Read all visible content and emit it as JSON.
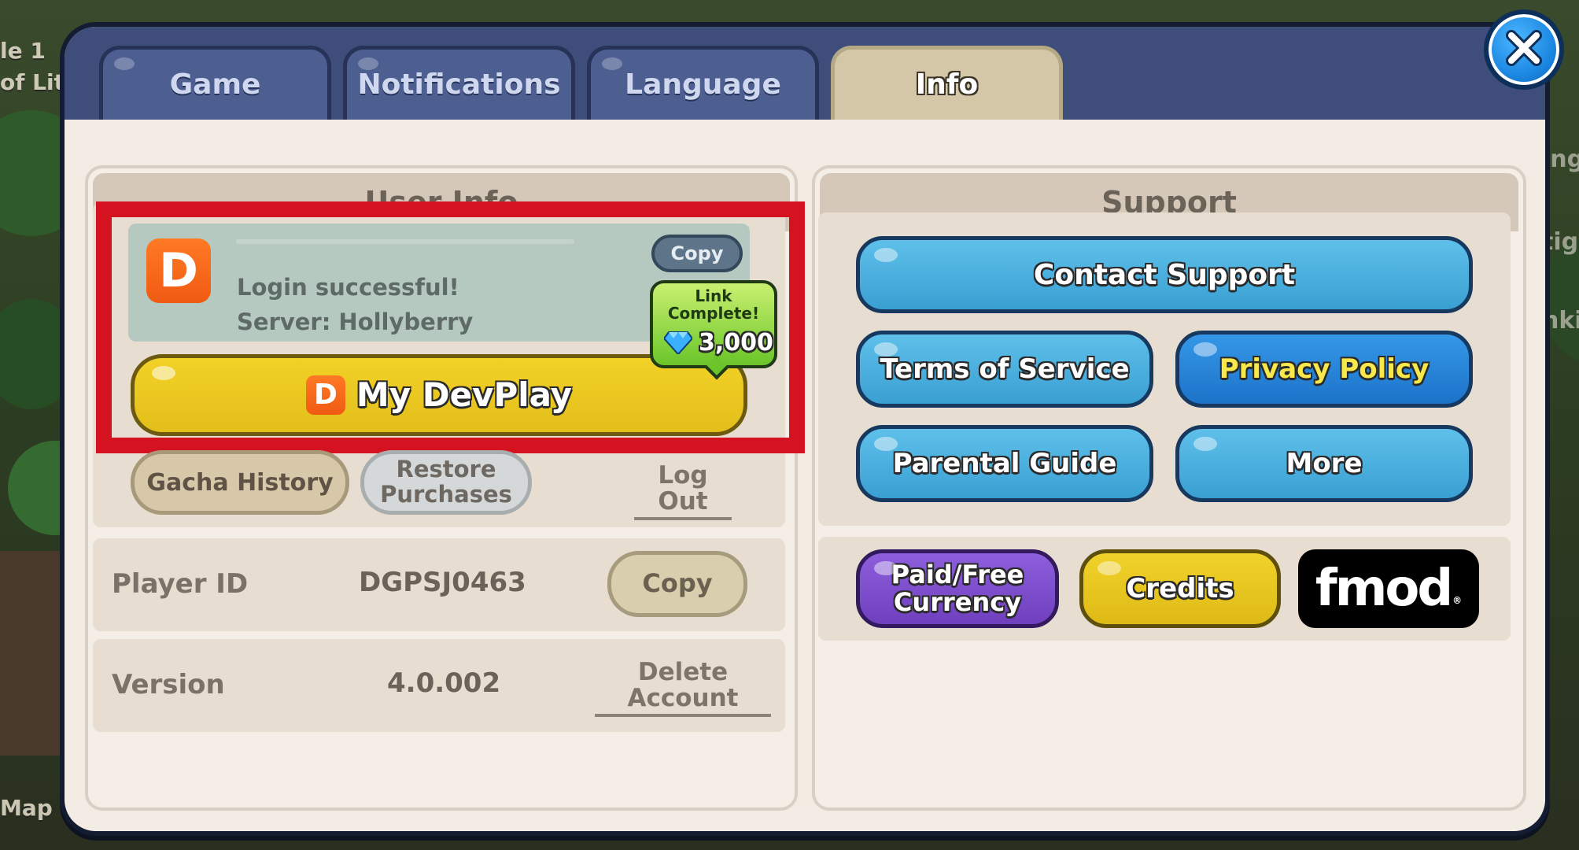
{
  "background": {
    "left_text_lines": [
      "le 1",
      "of Lit"
    ],
    "right_text_lines": [
      "ing",
      "tige",
      "nki"
    ],
    "map_label": "Map"
  },
  "tabs": [
    {
      "label": "Game",
      "active": false
    },
    {
      "label": "Notifications",
      "active": false
    },
    {
      "label": "Language",
      "active": false
    },
    {
      "label": "Info",
      "active": true
    }
  ],
  "close_icon": "close-x-icon",
  "user_info": {
    "title": "User Info",
    "logo_letter": "D",
    "status": "Login successful!",
    "server": "Server: Hollyberry",
    "copy_label": "Copy",
    "badge": {
      "line1": "Link",
      "line2": "Complete!",
      "amount": "3,000",
      "icon": "diamond-icon"
    },
    "devplay_button": {
      "logo_letter": "D",
      "label": "My DevPlay"
    },
    "gacha_history_label": "Gacha History",
    "restore_purchases_line1": "Restore",
    "restore_purchases_line2": "Purchases",
    "logout_label": "Log Out",
    "player_id_label": "Player ID",
    "player_id_value": "DGPSJ0463",
    "player_id_copy": "Copy",
    "version_label": "Version",
    "version_value": "4.0.002",
    "delete_account_line1": "Delete",
    "delete_account_line2": "Account"
  },
  "support": {
    "title": "Support",
    "contact_support": "Contact Support",
    "terms_of_service": "Terms of Service",
    "privacy_policy": "Privacy Policy",
    "parental_guide": "Parental Guide",
    "more": "More",
    "paid_free_line1": "Paid/Free",
    "paid_free_line2": "Currency",
    "credits": "Credits",
    "fmod_logo_text": "fmod"
  },
  "colors": {
    "tab_active": "#d3c7a8",
    "tab_inactive": "#4d5f91",
    "devplay_yellow": "#e8c61e",
    "support_blue": "#45a9d8",
    "privacy_blue": "#1f7fd6",
    "purple": "#7c4cc8",
    "highlight_red": "#d5121f",
    "badge_green": "#6bc52a"
  }
}
